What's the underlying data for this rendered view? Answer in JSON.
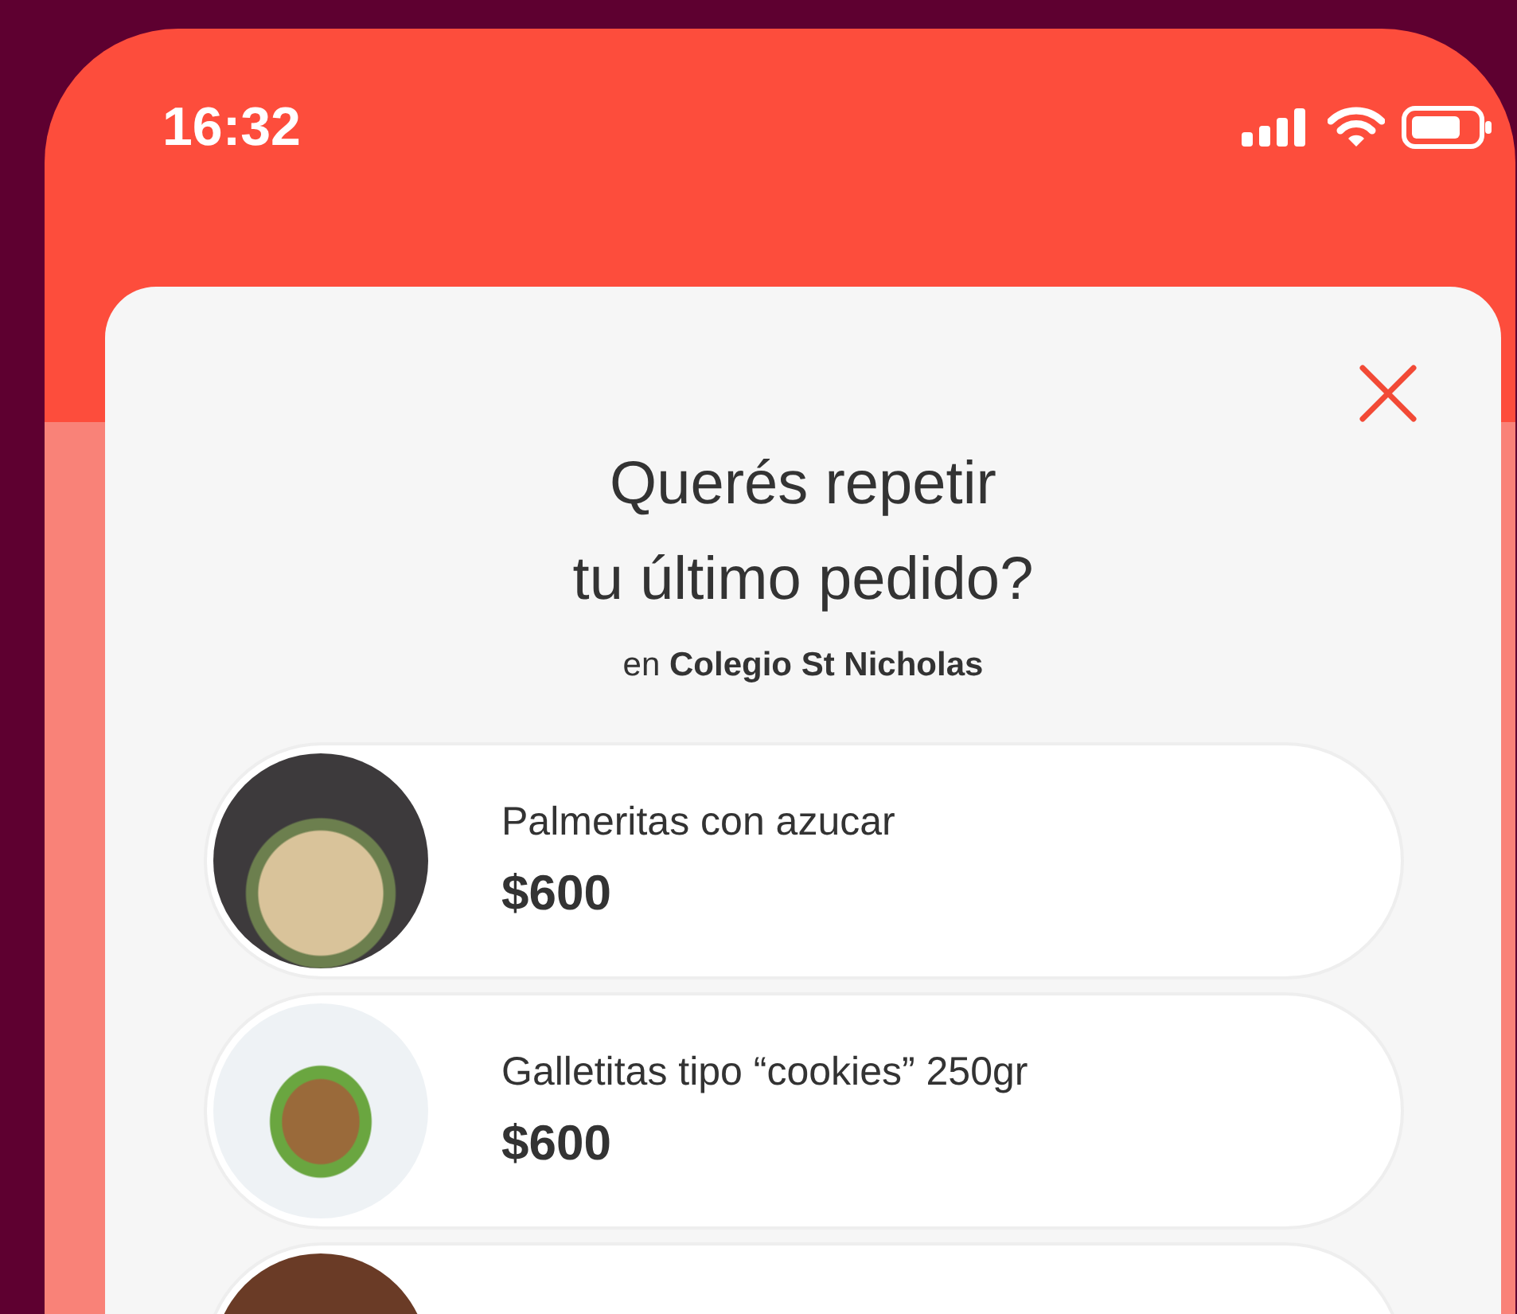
{
  "status_bar": {
    "time": "16:32"
  },
  "modal": {
    "title_lines": [
      "Querés repetir",
      "tu último pedido?"
    ],
    "subtitle": "en **Colegio St Nicholas**",
    "items": [
      {
        "kind": "full",
        "name": "Palmeritas con azucar",
        "price": "$600"
      },
      {
        "kind": "full",
        "name": "Galletitas tipo “cookies” 250gr",
        "price": "$600"
      },
      {
        "kind": "partial"
      }
    ]
  }
}
